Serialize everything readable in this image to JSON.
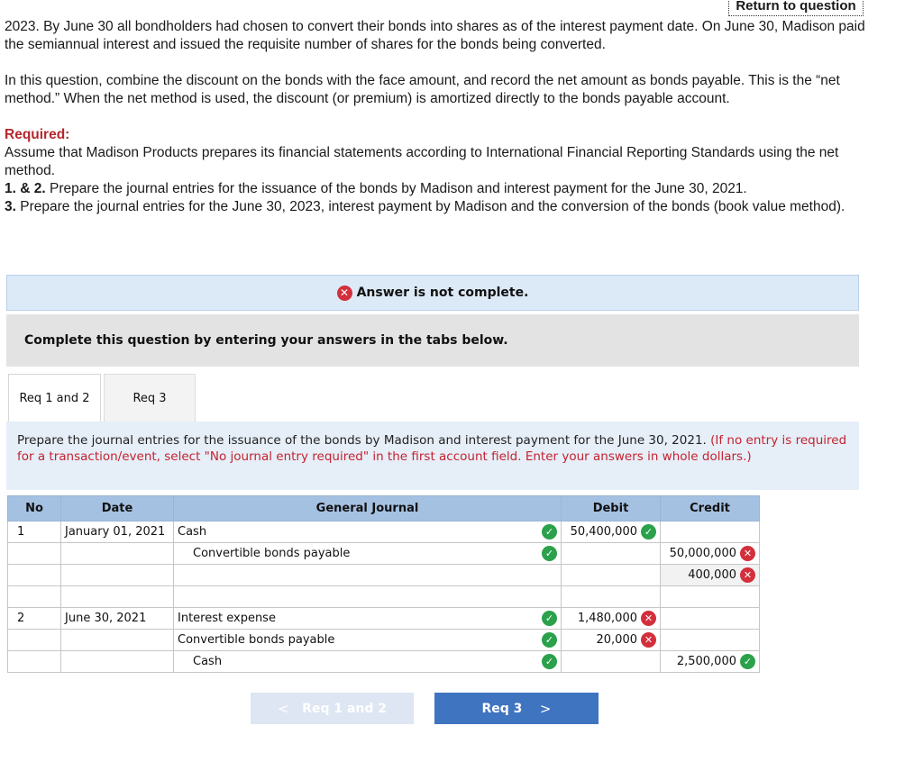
{
  "header": {
    "return_link": "Return to question"
  },
  "intro": {
    "p1": "2023. By June 30 all bondholders had chosen to convert their bonds into shares as of the interest payment date. On June 30, Madison paid the semiannual interest and issued the requisite number of shares for the bonds being converted.",
    "p2": "In this question, combine the discount on the bonds with the face amount, and record the net amount as bonds payable. This is the “net method.” When the net method is used, the discount (or premium) is amortized directly to the bonds payable account.",
    "required_heading": "Required:",
    "required_text": "Assume that Madison Products prepares its financial statements according to International Financial Reporting Standards using the net method.",
    "req1_prefix": "1. & 2.",
    "req1_text": " Prepare the journal entries for the issuance of the bonds by Madison and interest payment for the June 30, 2021.",
    "req3_prefix": "3.",
    "req3_text": " Prepare the journal entries for the June 30, 2023, interest payment by Madison and the conversion of the bonds (book value method)."
  },
  "alert": {
    "text": "Answer is not complete."
  },
  "instructions": {
    "text": "Complete this question by entering your answers in the tabs below."
  },
  "tabs": [
    {
      "label": "Req 1 and 2",
      "active": true
    },
    {
      "label": "Req 3",
      "active": false
    }
  ],
  "tab_content": {
    "text": "Prepare the journal entries for the issuance of the bonds by Madison and interest payment for the June 30, 2021.",
    "note": "(If no entry is required for a transaction/event, select \"No journal entry required\" in the first account field. Enter your answers in whole dollars.)"
  },
  "journal": {
    "headers": {
      "no": "No",
      "date": "Date",
      "general_journal": "General Journal",
      "debit": "Debit",
      "credit": "Credit"
    },
    "rows": [
      {
        "no": "1",
        "date": "January 01, 2021",
        "account": "Cash",
        "account_status": "correct",
        "debit": "50,400,000",
        "debit_status": "correct",
        "credit": "",
        "credit_status": ""
      },
      {
        "no": "",
        "date": "",
        "account": "Convertible bonds payable",
        "account_status": "correct",
        "debit": "",
        "debit_status": "",
        "credit": "50,000,000",
        "credit_status": "incorrect"
      },
      {
        "no": "",
        "date": "",
        "account": "",
        "account_status": "",
        "debit": "",
        "debit_status": "",
        "credit": "400,000",
        "credit_status": "incorrect"
      },
      {
        "no": "",
        "date": "",
        "account": "",
        "account_status": "",
        "debit": "",
        "debit_status": "",
        "credit": "",
        "credit_status": ""
      },
      {
        "no": "2",
        "date": "June 30, 2021",
        "account": "Interest expense",
        "account_status": "correct",
        "debit": "1,480,000",
        "debit_status": "incorrect",
        "credit": "",
        "credit_status": ""
      },
      {
        "no": "",
        "date": "",
        "account": "Convertible bonds payable",
        "account_status": "correct",
        "debit": "20,000",
        "debit_status": "incorrect",
        "credit": "",
        "credit_status": ""
      },
      {
        "no": "",
        "date": "",
        "account": "Cash",
        "account_status": "correct",
        "debit": "",
        "debit_status": "",
        "credit": "2,500,000",
        "credit_status": "correct"
      }
    ]
  },
  "nav": {
    "prev_label": "Req 1 and 2",
    "next_label": "Req 3"
  },
  "colors": {
    "alert_bg": "#dce9f7",
    "header_bg": "#a5c1e2",
    "correct": "#2aa14a",
    "incorrect": "#d32f3c",
    "next_btn": "#3f74c0"
  }
}
